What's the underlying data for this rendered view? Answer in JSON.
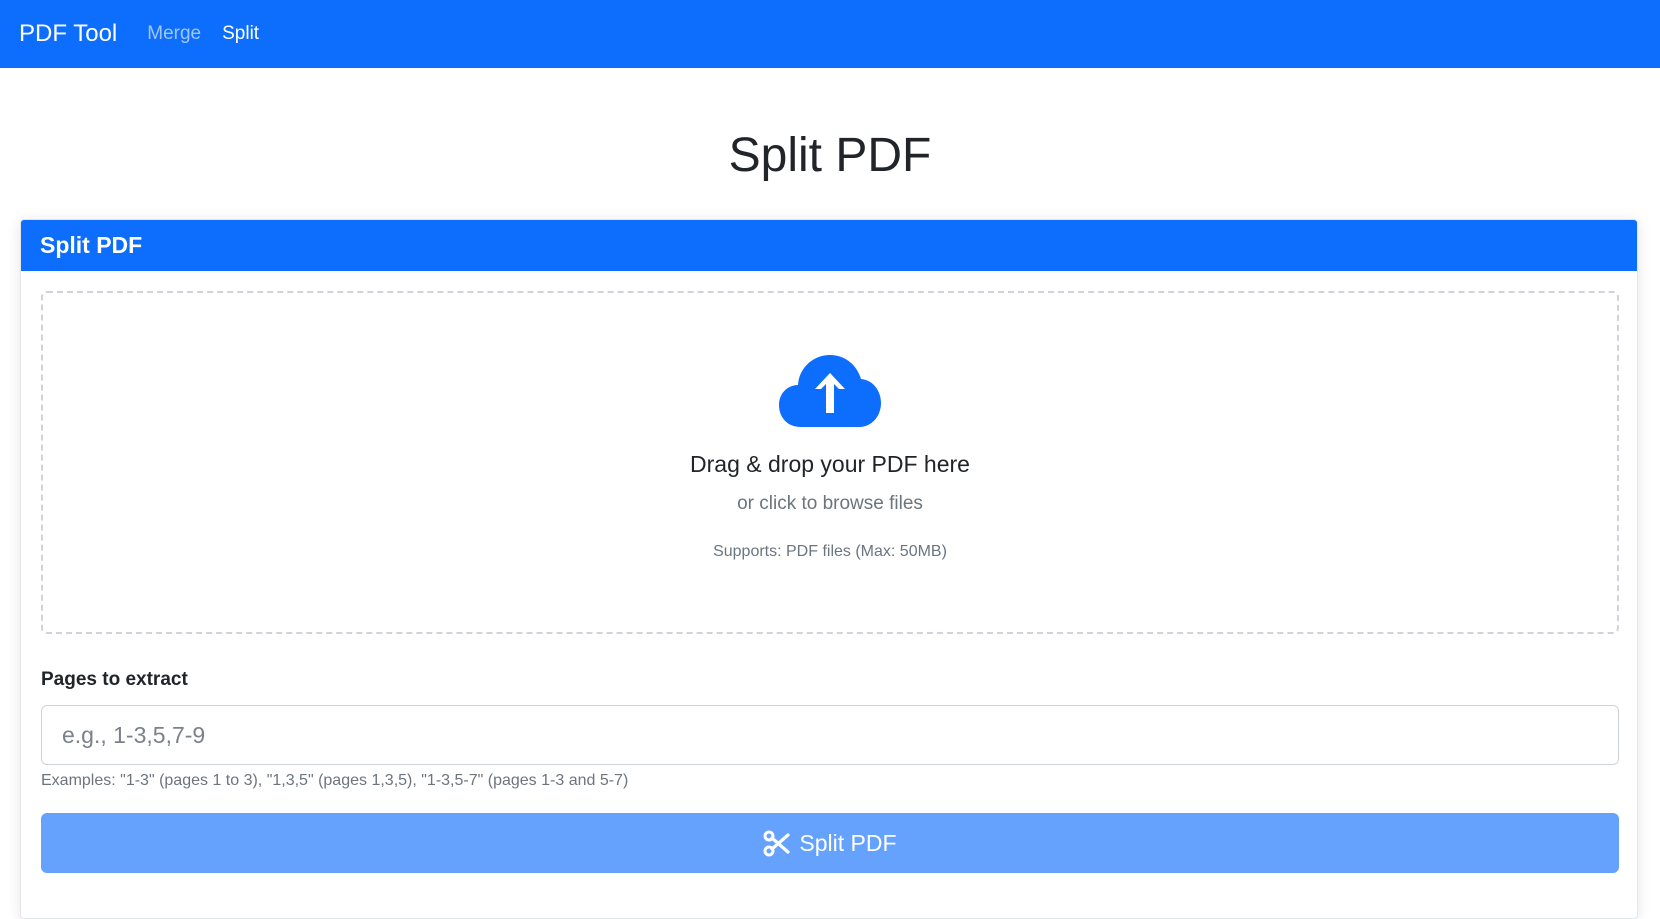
{
  "navbar": {
    "brand": "PDF Tool",
    "links": [
      {
        "label": "Merge",
        "active": false
      },
      {
        "label": "Split",
        "active": true
      }
    ],
    "background_color": "#0d6efd"
  },
  "page": {
    "title": "Split PDF"
  },
  "card": {
    "header": "Split PDF",
    "dropzone": {
      "icon": "cloud-upload-icon",
      "title": "Drag & drop your PDF here",
      "subtitle": "or click to browse files",
      "note": "Supports: PDF files (Max: 50MB)"
    },
    "pages_field": {
      "label": "Pages to extract",
      "value": "",
      "placeholder": "e.g., 1-3,5,7-9",
      "help": "Examples: \"1-3\" (pages 1 to 3), \"1,3,5\" (pages 1,3,5), \"1-3,5-7\" (pages 1-3 and 5-7)"
    },
    "submit_button": {
      "icon": "scissors-icon",
      "label": "Split PDF",
      "disabled": true
    }
  },
  "colors": {
    "primary": "#0d6efd",
    "button_disabled": "#64a2fd",
    "muted_text": "#6c757d"
  }
}
